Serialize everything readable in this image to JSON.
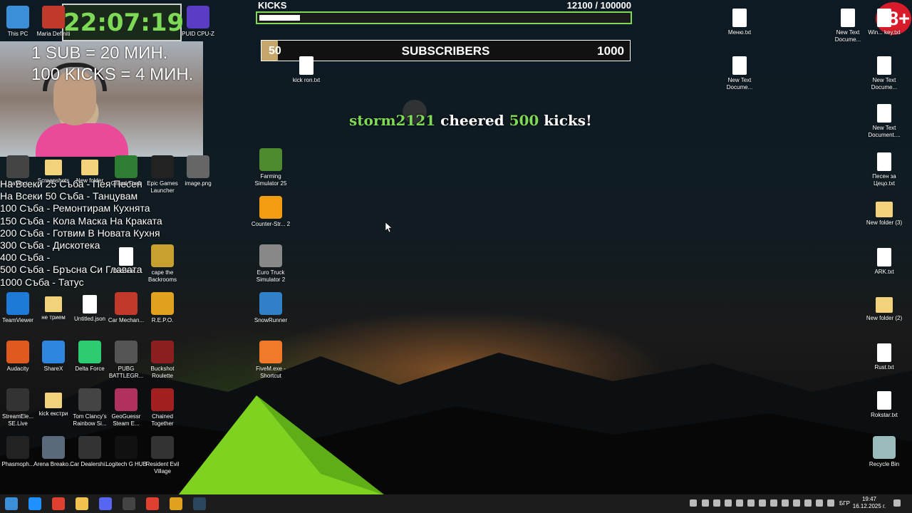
{
  "stream": {
    "clock": "22:07:19",
    "rule_sub": "1 SUB = 20 МИН.",
    "rule_kicks": "100 KICKS = 4 МИН.",
    "age_badge": "18+",
    "kicks": {
      "title": "KICKS",
      "current": "12100",
      "goal": "/ 100000",
      "progress_fraction": 0.121
    },
    "subs": {
      "current": "50",
      "label": "SUBSCRIBERS",
      "goal": "1000",
      "progress_fraction": 0.05
    },
    "cheer": {
      "user": "storm2121",
      "verb": "cheered",
      "amount": "500",
      "unit": "kicks!"
    },
    "goals": [
      "На Всеки 25 Съба - Пея Песен",
      "На Всеки 50 Съба - Танцувам",
      "100 Съба - Ремонтирам Кухнята",
      "150 Съба - Кола Маска На Краката",
      "200 Съба - Готвим В Новата Кухня",
      "300 Съба - Дискотека",
      "400 Съба - ",
      "500 Съба - Бръсна Си Главата",
      "1000 Съба - Татус"
    ]
  },
  "desktop": {
    "icons": [
      {
        "label": "This PC",
        "color": "#3b8fd9"
      },
      {
        "label": "Maria Definiti",
        "color": "#c0392b"
      },
      {
        "label": "PUID CPU-Z",
        "color": "#5b3cc4"
      },
      {
        "label": "DaVinci",
        "color": "#444"
      },
      {
        "label": "Screenshots",
        "color": "#f2d27a"
      },
      {
        "label": "New folder",
        "color": "#f2d27a"
      },
      {
        "label": "Grand Theft",
        "color": "#2e7d32"
      },
      {
        "label": "Epic Games Launcher",
        "color": "#222"
      },
      {
        "label": "image.png",
        "color": "#666"
      },
      {
        "label": "Farming Simulator 25",
        "color": "#4e8a2e"
      },
      {
        "label": "Counter-Str... 2",
        "color": "#f39c12"
      },
      {
        "label": "Euro Truck Simulator 2",
        "color": "#888"
      },
      {
        "label": "SnowRunner",
        "color": "#2f80c7"
      },
      {
        "label": "FiveM.exe - Shortcut",
        "color": "#f07a2a"
      },
      {
        "label": "kick ron.txt",
        "color": "#ddd"
      },
      {
        "label": "TeamViewer",
        "color": "#1e7ad6"
      },
      {
        "label": "не трием",
        "color": "#f2d27a"
      },
      {
        "label": "Untitled.json",
        "color": "#fff"
      },
      {
        "label": "Car Mechan...",
        "color": "#c0392b"
      },
      {
        "label": "R.E.P.O.",
        "color": "#e0a020"
      },
      {
        "label": "cape the Backrooms",
        "color": "#c8a030"
      },
      {
        "label": "Docume...",
        "color": "#fff"
      },
      {
        "label": "Audacity",
        "color": "#e05a20"
      },
      {
        "label": "ShareX",
        "color": "#2e86de"
      },
      {
        "label": "Delta Force",
        "color": "#2ecc71"
      },
      {
        "label": "PUBG BATTLEGR...",
        "color": "#555"
      },
      {
        "label": "Buckshot Roulette",
        "color": "#8b1e1e"
      },
      {
        "label": "StreamEle... SE.Live",
        "color": "#333"
      },
      {
        "label": "kick екстри",
        "color": "#f2d27a"
      },
      {
        "label": "Tom Clancy's Rainbow Si...",
        "color": "#444"
      },
      {
        "label": "GeoGuessr Steam E...",
        "color": "#b03060"
      },
      {
        "label": "Chained Together",
        "color": "#a02020"
      },
      {
        "label": "Phasmoph...",
        "color": "#222"
      },
      {
        "label": "Arena Breako...",
        "color": "#5a6a7a"
      },
      {
        "label": "Car Dealershi...",
        "color": "#333"
      },
      {
        "label": "Logitech G HUB",
        "color": "#111"
      },
      {
        "label": "Resident Evil Village",
        "color": "#333"
      },
      {
        "label": "Меню.txt",
        "color": "#fff"
      },
      {
        "label": "New Text Docume...",
        "color": "#fff"
      },
      {
        "label": "New Text Docume...",
        "color": "#fff"
      },
      {
        "label": "Win... key.txt",
        "color": "#fff"
      },
      {
        "label": "New Text Docume...",
        "color": "#fff"
      },
      {
        "label": "New Text Document....",
        "color": "#fff"
      },
      {
        "label": "Песен за Цецо.txt",
        "color": "#fff"
      },
      {
        "label": "New folder (3)",
        "color": "#f2d27a"
      },
      {
        "label": "ARK.txt",
        "color": "#fff"
      },
      {
        "label": "New folder (2)",
        "color": "#f2d27a"
      },
      {
        "label": "Rust.txt",
        "color": "#fff"
      },
      {
        "label": "Rokstar.txt",
        "color": "#fff"
      },
      {
        "label": "Recycle Bin",
        "color": "#9bb"
      }
    ]
  },
  "taskbar": {
    "language": "БГР",
    "time": "19:47",
    "date": "16.12.2025 г.",
    "apps": [
      {
        "name": "start-icon",
        "color": "#3b8fd9"
      },
      {
        "name": "edge-icon",
        "color": "#1e90ff"
      },
      {
        "name": "chrome-icon",
        "color": "#e04030"
      },
      {
        "name": "explorer-icon",
        "color": "#f2c14e"
      },
      {
        "name": "discord-icon",
        "color": "#5865f2"
      },
      {
        "name": "obs-icon",
        "color": "#444"
      },
      {
        "name": "chrome2-icon",
        "color": "#e04030"
      },
      {
        "name": "winamp-icon",
        "color": "#e0a020"
      },
      {
        "name": "steam-icon",
        "color": "#2a475e"
      }
    ]
  }
}
